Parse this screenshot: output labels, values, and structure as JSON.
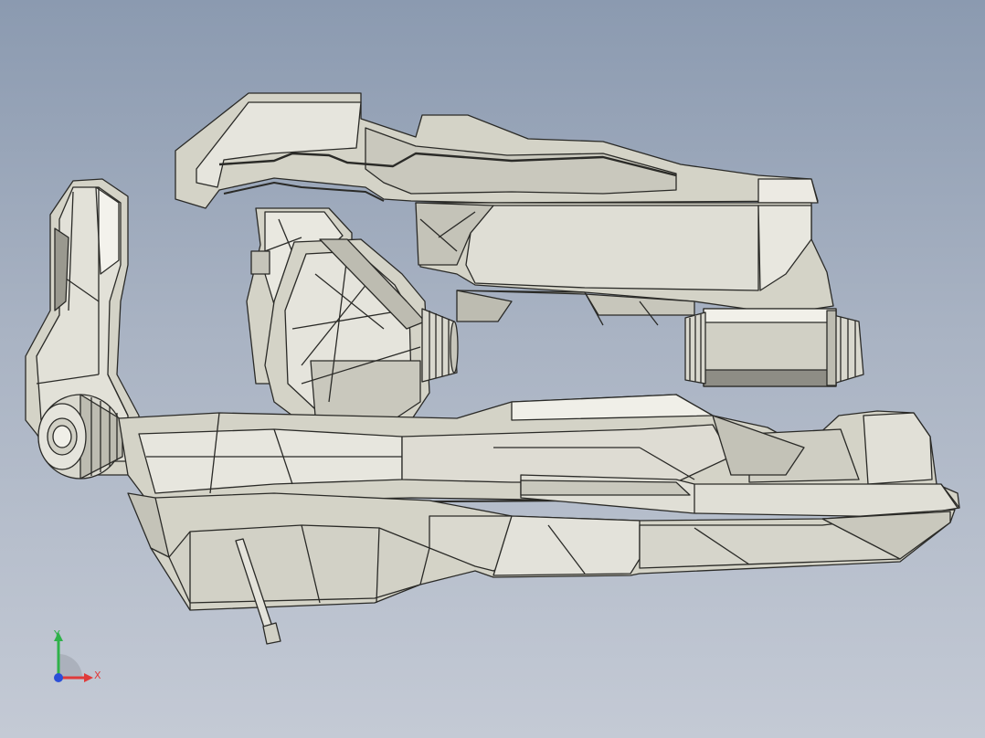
{
  "viewport": {
    "background_top": "#8b9ab0",
    "background_bottom": "#c4cad5",
    "model": {
      "fill": "#d4d3c7",
      "fill_light": "#f2f1ec",
      "fill_dark": "#8d8c84",
      "edge": "#2a2a27"
    }
  },
  "triad": {
    "x_label": "X",
    "y_label": "Y",
    "x_color": "#e03a3a",
    "y_color": "#2fb24a",
    "z_color": "#2b4fd8"
  }
}
